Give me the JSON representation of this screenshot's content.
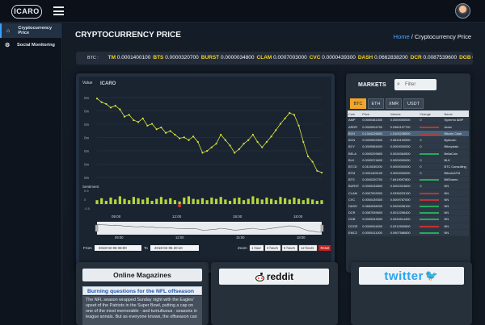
{
  "app": {
    "logo_text": "ICARO"
  },
  "sidebar": {
    "items": [
      {
        "label": "Cryptocurrency Price",
        "icon": "home-icon",
        "active": true
      },
      {
        "label": "Social Monitoring",
        "icon": "gear-icon",
        "active": false
      }
    ]
  },
  "header": {
    "page_title": "CRYPTOCURRENCY PRICE",
    "breadcrumb": {
      "home": "Home",
      "separator": "/",
      "current": "Cryptocurrency Price"
    }
  },
  "ticker": {
    "label": "BTC :",
    "items": [
      {
        "symbol": "TM",
        "value": "0.0001400100"
      },
      {
        "symbol": "BTS",
        "value": "0.0000320700"
      },
      {
        "symbol": "BURST",
        "value": "0.0000034800"
      },
      {
        "symbol": "CLAM",
        "value": "0.0007003000"
      },
      {
        "symbol": "CVC",
        "value": "0.0000439300"
      },
      {
        "symbol": "DASH",
        "value": "0.0662838200"
      },
      {
        "symbol": "DCR",
        "value": "0.0087539600"
      },
      {
        "symbol": "DGB",
        "value": "0."
      }
    ]
  },
  "chart": {
    "title": "Value",
    "watermark": "ICARO",
    "y_tick_labels": [
      "0m",
      "0m",
      "0m",
      "0m",
      "0m",
      "0m",
      "0m"
    ],
    "sentiment_label": "Sentiment",
    "sentiment_ticks": [
      "0.5",
      "0",
      "-0.5"
    ],
    "x_tick_labels": [
      "09:00",
      "12:00",
      "15:00",
      "18:00"
    ],
    "navigator_labels": [
      "09:00",
      "12:00",
      "15:00",
      "18:00"
    ],
    "from_label": "From",
    "from_value": "2018-02-05 08:00",
    "to_label": "To",
    "to_value": "2018-02-05 20:10",
    "zoom_label": "Zoom",
    "zoom_buttons": [
      "1 hour",
      "3 hours",
      "6 hours",
      "12 hours"
    ],
    "reset_label": "Reset",
    "colors": {
      "line": "#d9e33a",
      "bar": "#b6d63a",
      "marker": "#e03030"
    }
  },
  "chart_data": {
    "type": "line",
    "title": "",
    "x": [
      "08:00",
      "08:15",
      "08:30",
      "08:45",
      "09:00",
      "09:15",
      "09:30",
      "09:45",
      "10:00",
      "10:15",
      "10:30",
      "10:45",
      "11:00",
      "11:15",
      "11:30",
      "11:45",
      "12:00",
      "12:15",
      "12:30",
      "12:45",
      "13:00",
      "13:15",
      "13:30",
      "13:45",
      "14:00",
      "14:15",
      "14:30",
      "14:45",
      "15:00",
      "15:15",
      "15:30",
      "15:45",
      "16:00",
      "16:15",
      "16:30",
      "16:45",
      "17:00",
      "17:15",
      "17:30",
      "17:45",
      "18:00",
      "18:15",
      "18:30",
      "18:45",
      "19:00",
      "19:15",
      "19:30",
      "19:45",
      "20:00",
      "20:10"
    ],
    "series": [
      {
        "name": "Value",
        "values": [
          0.9,
          0.86,
          0.84,
          0.8,
          0.82,
          0.78,
          0.7,
          0.72,
          0.66,
          0.64,
          0.68,
          0.6,
          0.62,
          0.56,
          0.58,
          0.52,
          0.54,
          0.5,
          0.46,
          0.47,
          0.44,
          0.48,
          0.42,
          0.3,
          0.32,
          0.36,
          0.4,
          0.5,
          0.44,
          0.38,
          0.3,
          0.34,
          0.4,
          0.44,
          0.5,
          0.42,
          0.36,
          0.42,
          0.48,
          0.55,
          0.62,
          0.68,
          0.74,
          0.72,
          0.6,
          0.42,
          0.26,
          0.2,
          0.1,
          0.08
        ]
      },
      {
        "name": "Sentiment",
        "values": [
          0.3,
          0.45,
          0.25,
          0.5,
          0.35,
          0.6,
          0.4,
          0.3,
          0.55,
          0.45,
          0.35,
          0.5,
          0.25,
          0.4,
          0.55,
          0.35,
          0.45,
          0.3,
          0.2,
          0.5,
          0.6,
          0.4,
          0.35,
          0.45,
          0.3,
          0.5,
          0.4,
          0.55,
          0.35,
          0.25,
          0.45,
          0.5,
          0.3,
          0.4,
          0.6,
          0.45,
          0.35,
          0.5,
          0.4,
          0.3,
          0.55,
          0.45,
          0.35,
          0.5,
          0.4,
          0.3,
          0.45,
          0.35,
          0.25,
          0.3
        ]
      }
    ],
    "xlabel": "",
    "ylabel": "Value",
    "ylim": [
      0,
      1
    ],
    "grid": true,
    "legend": "none"
  },
  "markets": {
    "title": "MARKETS",
    "filter_placeholder": "Filter",
    "tabs": [
      "BTC",
      "ETH",
      "XMR",
      "USDT"
    ],
    "active_tab": "BTC",
    "columns": [
      "Coin",
      "Price",
      "Volume",
      "Change",
      "Name"
    ],
    "rows": [
      {
        "coin": "AMP",
        "price": "0.0000381300",
        "volume": "0.0000000000",
        "change": "0",
        "dir": "none",
        "name": "Synereo AMP"
      },
      {
        "coin": "ARDR",
        "price": "0.0000504700",
        "volume": "0.0360197700",
        "change": "",
        "dir": "down",
        "name": "Ardor"
      },
      {
        "coin": "BCH",
        "price": "0.1344226600",
        "volume": "1.5100238500",
        "change": "",
        "dir": "down",
        "name": "Bitcoin Cash"
      },
      {
        "coin": "BCN",
        "price": "0.0000003300",
        "volume": "0.0815109900",
        "change": "0",
        "dir": "none",
        "name": "Bytecoin"
      },
      {
        "coin": "BCY",
        "price": "0.0000584000",
        "volume": "0.0000000000",
        "change": "0",
        "dir": "none",
        "name": "Bitcrystals"
      },
      {
        "coin": "BELA",
        "price": "0.0000209800",
        "volume": "0.0026364500",
        "change": "",
        "dir": "up",
        "name": "BellaCoin"
      },
      {
        "coin": "BLK",
        "price": "0.0000374600",
        "volume": "0.0000000000",
        "change": "0",
        "dir": "none",
        "name": "BLK"
      },
      {
        "coin": "BTCD",
        "price": "0.0115030200",
        "volume": "0.0000000000",
        "change": "0",
        "dir": "none",
        "name": "BTC Consulting"
      },
      {
        "coin": "BTM",
        "price": "0.0001409100",
        "volume": "0.0000000000",
        "change": "0",
        "dir": "none",
        "name": "BitcoinATM"
      },
      {
        "coin": "BTS",
        "price": "0.0000320700",
        "volume": "7.8419097800",
        "change": "",
        "dir": "up",
        "name": "BitShares"
      },
      {
        "coin": "BURST",
        "price": "0.0000034800",
        "volume": "0.0002313600",
        "change": "0",
        "dir": "none",
        "name": "NN"
      },
      {
        "coin": "CLAM",
        "price": "0.0007003000",
        "volume": "0.0336203100",
        "change": "",
        "dir": "down",
        "name": "NN"
      },
      {
        "coin": "CVC",
        "price": "0.0000439300",
        "volume": "0.0009787000",
        "change": "",
        "dir": "down",
        "name": "NN"
      },
      {
        "coin": "DASH",
        "price": "0.0662838200",
        "volume": "0.0200038100",
        "change": "",
        "dir": "up",
        "name": "NN"
      },
      {
        "coin": "DCR",
        "price": "0.0087539600",
        "volume": "0.0012296400",
        "change": "",
        "dir": "up",
        "name": "NN"
      },
      {
        "coin": "DGB",
        "price": "0.0000043000",
        "volume": "0.0034514400",
        "change": "",
        "dir": "up",
        "name": "NN"
      },
      {
        "coin": "DOGE",
        "price": "0.0000004000",
        "volume": "0.0212500800",
        "change": "",
        "dir": "down",
        "name": "NN"
      },
      {
        "coin": "EMC2",
        "price": "0.0000411000",
        "volume": "0.0907566800",
        "change": "",
        "dir": "up",
        "name": "NN"
      }
    ]
  },
  "magazines": {
    "title": "Online Magazines",
    "headline": "Burning questions for the NFL offseason",
    "body": "The NFL season wrapped Sunday night with the Eagles' upset of the Patriots in the Super Bowl, putting a cap on one of the most memorable - and tumultuous - seasons in league annals. But as everyone knows, the offseason can"
  },
  "reddit": {
    "label": "reddit"
  },
  "twitter": {
    "label": "twitter"
  }
}
